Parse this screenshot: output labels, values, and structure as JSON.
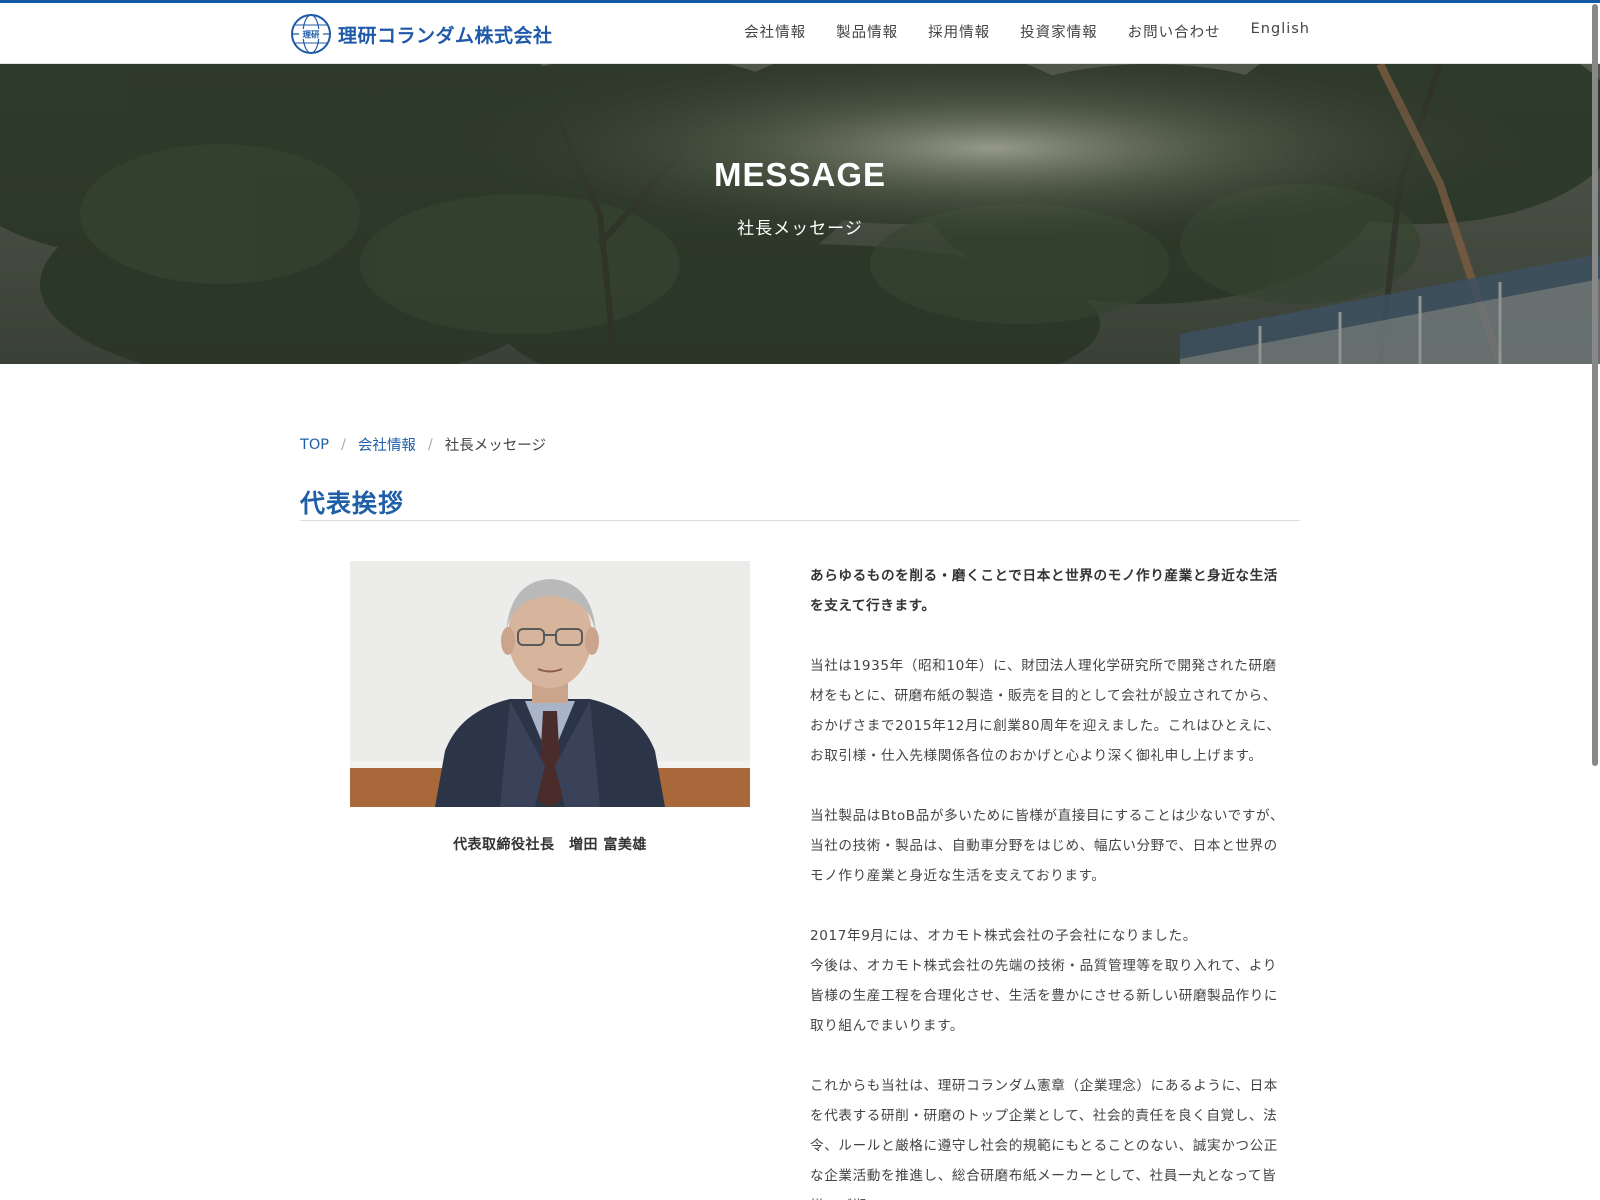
{
  "colors": {
    "accent": "#1259a8",
    "link": "#1f5fa8",
    "text": "#444444"
  },
  "header": {
    "logo_text": "理研コランダム株式会社",
    "logo_emblem_text": "理研",
    "nav": [
      "会社情報",
      "製品情報",
      "採用情報",
      "投資家情報",
      "お問い合わせ",
      "English"
    ]
  },
  "hero": {
    "title": "MESSAGE",
    "subtitle": "社長メッセージ"
  },
  "breadcrumb": {
    "items": [
      "TOP",
      "会社情報"
    ],
    "current": "社長メッセージ"
  },
  "page_title": "代表挨拶",
  "portrait": {
    "caption": "代表取締役社長　増田 富美雄"
  },
  "message": {
    "paragraphs": [
      "あらゆるものを削る・磨くことで日本と世界のモノ作り産業と身近な生活を支えて行きます。",
      "当社は1935年（昭和10年）に、財団法人理化学研究所で開発された研磨材をもとに、研磨布紙の製造・販売を目的として会社が設立されてから、おかげさまで2015年12月に創業80周年を迎えました。これはひとえに、お取引様・仕入先様関係各位のおかげと心より深く御礼申し上げます。",
      "当社製品はBtoB品が多いために皆様が直接目にすることは少ないですが、当社の技術・製品は、自動車分野をはじめ、幅広い分野で、日本と世界のモノ作り産業と身近な生活を支えております。",
      "2017年9月には、オカモト株式会社の子会社になりました。",
      "今後は、オカモト株式会社の先端の技術・品質管理等を取り入れて、より皆様の生産工程を合理化させ、生活を豊かにさせる新しい研磨製品作りに取り組んでまいります。",
      "これからも当社は、理研コランダム憲章（企業理念）にあるように、日本を代表する研削・研磨のトップ企業として、社会的責任を良く自覚し、法令、ルールと厳格に遵守し社会的規範にもとることのない、誠実かつ公正な企業活動を推進し、総合研磨布紙メーカーとして、社員一丸となって皆様のご期"
    ]
  }
}
